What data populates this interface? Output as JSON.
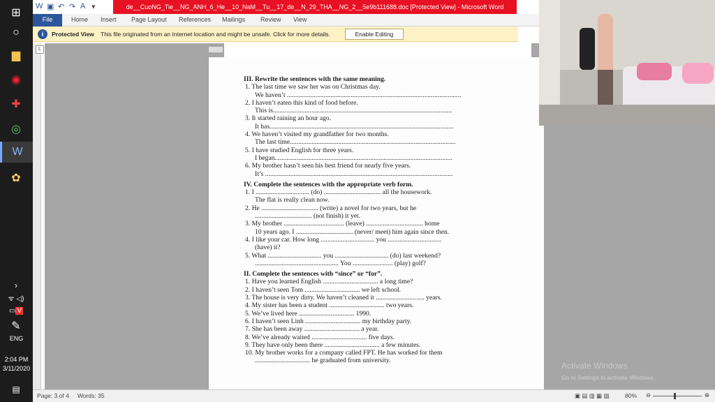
{
  "taskbar": {
    "language": "ENG",
    "time": "2:04 PM",
    "date": "3/11/2020"
  },
  "word": {
    "title": "de__CuoNG_Tie__NG_ANH_6_He__10_NaM__Tu__17_de__N_29_THA__NG_2__5e9b111688.doc [Protected View] - Microsoft Word",
    "tabs": [
      "File",
      "Home",
      "Insert",
      "Page Layout",
      "References",
      "Mailings",
      "Review",
      "View"
    ],
    "protected_view": {
      "label": "Protected View",
      "message": "This file originated from an Internet location and might be unsafe. Click for more details.",
      "button": "Enable Editing"
    },
    "status": {
      "page": "Page: 3 of 4",
      "words": "Words: 35",
      "zoom": "80%"
    },
    "watermark": {
      "title": "Activate Windows",
      "subtitle": "Go to Settings to activate Windows."
    }
  },
  "document": {
    "sections": [
      {
        "heading": "III. Rewrite the sentences with the same meaning.",
        "items": [
          {
            "q": "1. The last time we saw her was on Christmas day.",
            "a": "We haven’t ........................................................................................................"
          },
          {
            "q": "2. I haven’t eaten this kind of food before.",
            "a": "This is..........................................................................................................."
          },
          {
            "q": "3. It started raining an hour ago.",
            "a": "It has.............................................................................................................."
          },
          {
            "q": "4. We haven’t visited my grandfather for two months.",
            "a": "The last time..................................................................................................."
          },
          {
            "q": "5. I have studied English for three years.",
            "a": "I began.........................................................................................................."
          },
          {
            "q": "6. My brother hasn’t seen his best friend for nearly five years.",
            "a": "It’s ................................................................................................................"
          }
        ]
      },
      {
        "heading": "IV. Complete the sentences with the appropriate verb form.",
        "items": [
          {
            "q": "1. I ................................ (do) .................................. all the housework.",
            "a": "The flat is really clean now."
          },
          {
            "q": "2. He .................................. (write) a novel for two years, but he",
            "a": ".................................. (not finish) it yet."
          },
          {
            "q": "3. My brother .................................... (leave) .................................. home",
            "a": "10 years ago. I .................................. (never/ meet) him again since then."
          },
          {
            "q": "4. I like your car. How long ................................ you ................................",
            "a": "(have) it?"
          },
          {
            "q": "5. What ................................ you ................................ (do) last weekend?",
            "a": ".................................................. You ........................ (play) golf?"
          }
        ]
      },
      {
        "heading": "II. Complete the sentences with “since” or “for”.",
        "items": [
          {
            "q": "1. Have you learned English ................................. a long time?",
            "a": ""
          },
          {
            "q": "2. I haven’t seen Tom ................................. we left school.",
            "a": ""
          },
          {
            "q": "3. The house is very dirty. We haven’t cleaned it ............................. years.",
            "a": ""
          },
          {
            "q": "4. My sister has been a student ................................. two years.",
            "a": ""
          },
          {
            "q": "5. We’ve lived here ................................. 1990.",
            "a": ""
          },
          {
            "q": "6. I haven’t seen Linh ................................. my birthday party.",
            "a": ""
          },
          {
            "q": "7. She has been away ................................. a year.",
            "a": ""
          },
          {
            "q": "8. We’ve already waited ................................. five days.",
            "a": ""
          },
          {
            "q": "9. They have only been there ................................. a few minutes.",
            "a": ""
          },
          {
            "q": "10. My brother works for a company called FPT. He has worked for them",
            "a": "................................. he graduated from university."
          }
        ]
      }
    ]
  },
  "colors": {
    "title_red": "#e81123",
    "word_blue": "#2b579a",
    "protected_yellow": "#fdf2c5"
  }
}
